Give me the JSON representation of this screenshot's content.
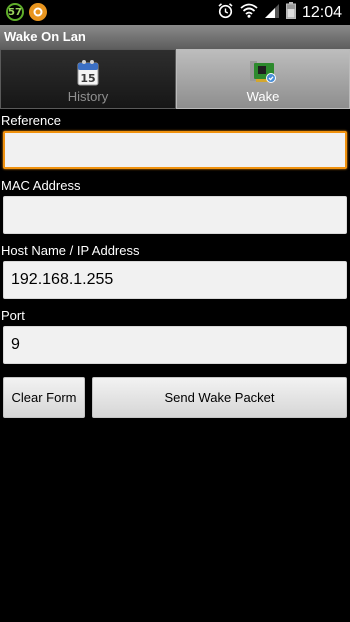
{
  "status_bar": {
    "notification_badge": "57",
    "time": "12:04",
    "icons": [
      "battery-57-icon",
      "orange-app-icon",
      "alarm-clock-icon",
      "wifi-icon",
      "signal-icon",
      "battery-icon"
    ]
  },
  "app": {
    "title": "Wake On Lan"
  },
  "tabs": [
    {
      "label": "History",
      "icon": "calendar-icon",
      "selected": false
    },
    {
      "label": "Wake",
      "icon": "network-card-icon",
      "selected": true
    }
  ],
  "form": {
    "reference": {
      "label": "Reference",
      "value": ""
    },
    "mac": {
      "label": "MAC Address",
      "value": ""
    },
    "host": {
      "label": "Host Name / IP Address",
      "value": "192.168.1.255"
    },
    "port": {
      "label": "Port",
      "value": "9"
    }
  },
  "buttons": {
    "clear_label": "Clear Form",
    "send_label": "Send Wake Packet"
  },
  "colors": {
    "focus_accent": "#f0920f",
    "background": "#000000"
  }
}
